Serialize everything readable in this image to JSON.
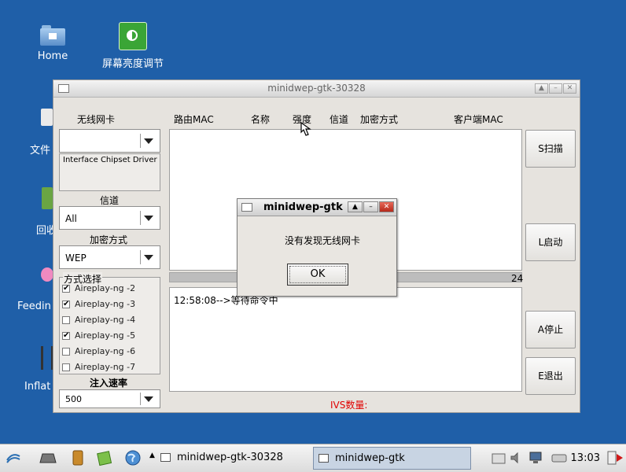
{
  "desktop": {
    "icons": [
      {
        "label": "Home"
      },
      {
        "label": "屏幕亮度调节"
      }
    ],
    "partial_labels": [
      "文件",
      "回收",
      "Feedin",
      "Inflat"
    ]
  },
  "window": {
    "title": "minidwep-gtk-30328",
    "left": {
      "wireless_card_label": "无线网卡",
      "wireless_card_value": "",
      "info_text": "Interface Chipset Driver",
      "channel_label": "信道",
      "channel_value": "All",
      "encryption_label": "加密方式",
      "encryption_value": "WEP",
      "mode_label": "方式选择",
      "modes": [
        {
          "label": "Aireplay-ng -2",
          "checked": "✔"
        },
        {
          "label": "Aireplay-ng -3",
          "checked": "✔"
        },
        {
          "label": "Aireplay-ng -4",
          "checked": ""
        },
        {
          "label": "Aireplay-ng -5",
          "checked": "✔"
        },
        {
          "label": "Aireplay-ng -6",
          "checked": ""
        },
        {
          "label": "Aireplay-ng -7",
          "checked": ""
        }
      ],
      "inject_rate_label": "注入速率",
      "inject_rate_value": "500"
    },
    "columns": [
      "路由MAC",
      "名称",
      "强度",
      "信道",
      "加密方式",
      "客户端MAC"
    ],
    "progress_value": "24",
    "log_text": "12:58:08-->等待命令中",
    "ivs_label": "IVS数量:",
    "buttons": {
      "scan": "S扫描",
      "start": "L启动",
      "stop": "A停止",
      "exit": "E退出"
    }
  },
  "dialog": {
    "title": "minidwep-gtk",
    "message": "没有发现无线网卡",
    "ok": "OK"
  },
  "taskbar": {
    "tasks": [
      "minidwep-gtk-30328",
      "minidwep-gtk"
    ],
    "clock": "13:03"
  },
  "colors": {
    "desktop": "#1f5fa8",
    "ivs_label": "#e00000"
  }
}
